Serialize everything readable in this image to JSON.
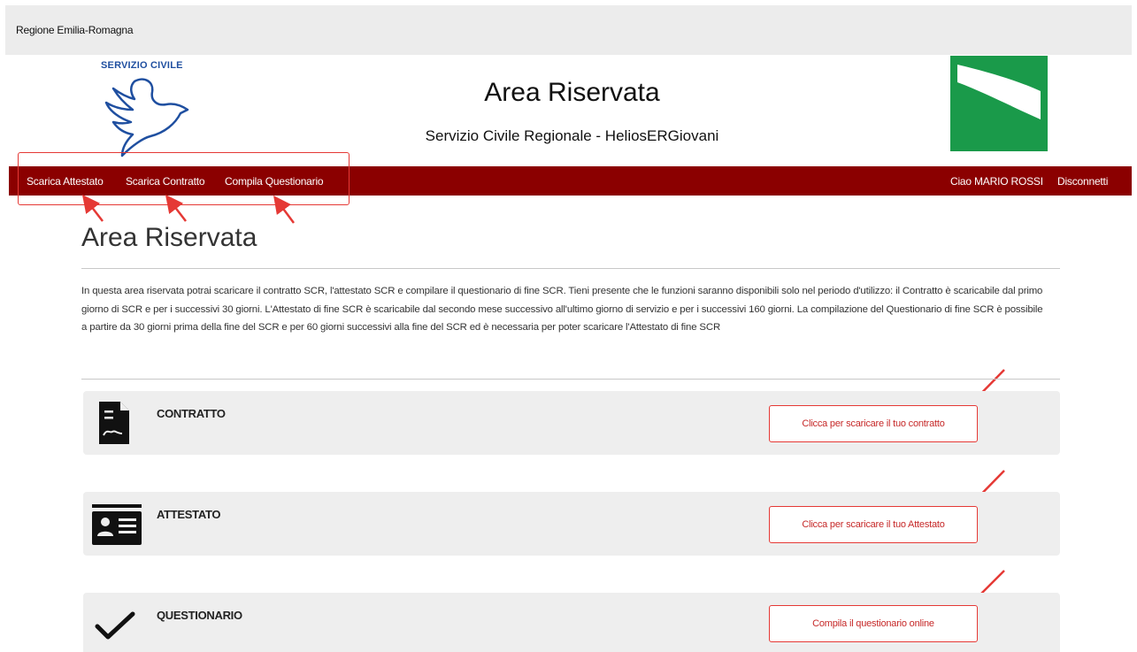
{
  "topbar": {
    "label": "Regione Emilia-Romagna"
  },
  "logo": {
    "text": "SERVIZIO CIVILE"
  },
  "header": {
    "title": "Area Riservata",
    "subtitle": "Servizio Civile Regionale - HeliosERGiovani"
  },
  "nav": {
    "items": [
      "Scarica Attestato",
      "Scarica Contratto",
      "Compila Questionario"
    ],
    "greeting": "Ciao MARIO ROSSI",
    "logout": "Disconnetti"
  },
  "main": {
    "title": "Area Riservata",
    "intro": "In questa area riservata potrai scaricare il contratto SCR, l'attestato SCR e compilare il questionario di fine SCR. Tieni presente che le funzioni saranno disponibili solo nel periodo d'utilizzo: il Contratto è scaricabile dal primo giorno di SCR e per i successivi 30 giorni. L'Attestato di fine SCR è scaricabile dal secondo mese successivo all'ultimo giorno di servizio e per i successivi 160 giorni. La compilazione del Questionario di fine SCR è possibile a partire da 30 giorni prima della fine del SCR e per 60 giorni successivi alla fine del SCR ed è necessaria per poter scaricare l'Attestato di fine SCR"
  },
  "cards": [
    {
      "label": "CONTRATTO",
      "button": "Clicca per scaricare il tuo contratto",
      "icon": "document-icon"
    },
    {
      "label": "ATTESTATO",
      "button": "Clicca per scaricare il tuo Attestato",
      "icon": "id-card-icon"
    },
    {
      "label": "QUESTIONARIO",
      "button": "Compila il questionario online",
      "icon": "checkmark-icon"
    }
  ],
  "colors": {
    "nav_bg": "#8b0000",
    "annotation": "#e53935",
    "region_green": "#1a9a4a"
  }
}
